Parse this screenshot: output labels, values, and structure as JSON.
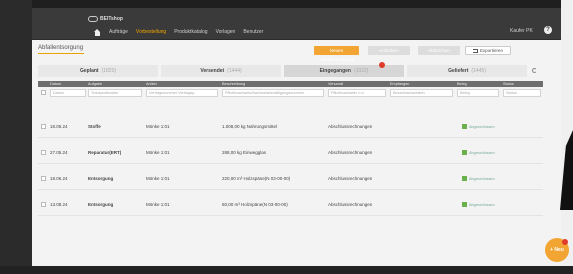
{
  "app": {
    "brand": "BEITshop",
    "user_name": "Kaufer PK"
  },
  "nav": {
    "items": [
      {
        "label": "Aufträge"
      },
      {
        "label": "Vorbestellung",
        "active": true
      },
      {
        "label": "Produktkatalog"
      },
      {
        "label": "Vorlagen"
      },
      {
        "label": "Benutzer"
      }
    ]
  },
  "toolbar": {
    "title": "Abfallentsorgung",
    "primary_button": "Neuen Abfallentsorgung",
    "button_2": "Anfordern",
    "button_3": "Abbrechen",
    "export_button": "Exportieren"
  },
  "tabs": [
    {
      "label": "Geplant",
      "count": "(1820)"
    },
    {
      "label": "Versendet",
      "count": "(1444)"
    },
    {
      "label": "Eingegangen",
      "count": "(1022)",
      "active": true,
      "has_badge": true
    },
    {
      "label": "Geliefert",
      "count": "(1445)"
    }
  ],
  "table": {
    "headers": [
      "Datum",
      "Aufgabe",
      "Artikel",
      "Beschreibung",
      "Versandt",
      "Empfangen",
      "Beleg",
      "Status"
    ],
    "filters": [
      "Datum",
      "Transportkosten",
      "Vertragsnummer Vertragsp.",
      "Pflichtnachweis/Nachweisbestätigungsnummer",
      "Pflichtnachweis n.d.",
      "Bezahlnachweisen",
      "Beleg",
      "Status"
    ],
    "rows": [
      {
        "date": "18.05.24",
        "task": "Stoffe",
        "article": "Mönke 1:01",
        "description": "1.008,00 kg Nahrungsmittel",
        "received": "Abschlussrechnungen",
        "status": "Abgeschlossen"
      },
      {
        "date": "27.05.24",
        "task": "Reparatur(ERT)",
        "article": "Mönke 1:01",
        "description": "288,00 kg Einwegglas",
        "received": "Abschlussrechnungen",
        "status": "Abgeschlossen"
      },
      {
        "date": "18.06.24",
        "task": "Entsorgung",
        "article": "Mönke 1:01",
        "description": "220,00 m³ Holzspäne(N 03-00-00)",
        "received": "Abschlussrechnungen",
        "status": "Abgeschlossen"
      },
      {
        "date": "13.08.24",
        "task": "Entsorgung",
        "article": "Mönke 1:01",
        "description": "60,00 m³ Holzspäne(N 03-00-00)",
        "received": "Abschlussrechnungen",
        "status": "Abgeschlossen"
      }
    ]
  },
  "fab_label": "+ Neu",
  "colors": {
    "accent": "#f2a533",
    "nav_active": "#f2a500",
    "badge": "#e03a2a",
    "status_ok": "#6ab04c",
    "header_bg": "#6e6e6e"
  },
  "icons": [
    "home-icon",
    "help-icon",
    "export-icon",
    "refresh-icon",
    "checkbox-icon"
  ]
}
